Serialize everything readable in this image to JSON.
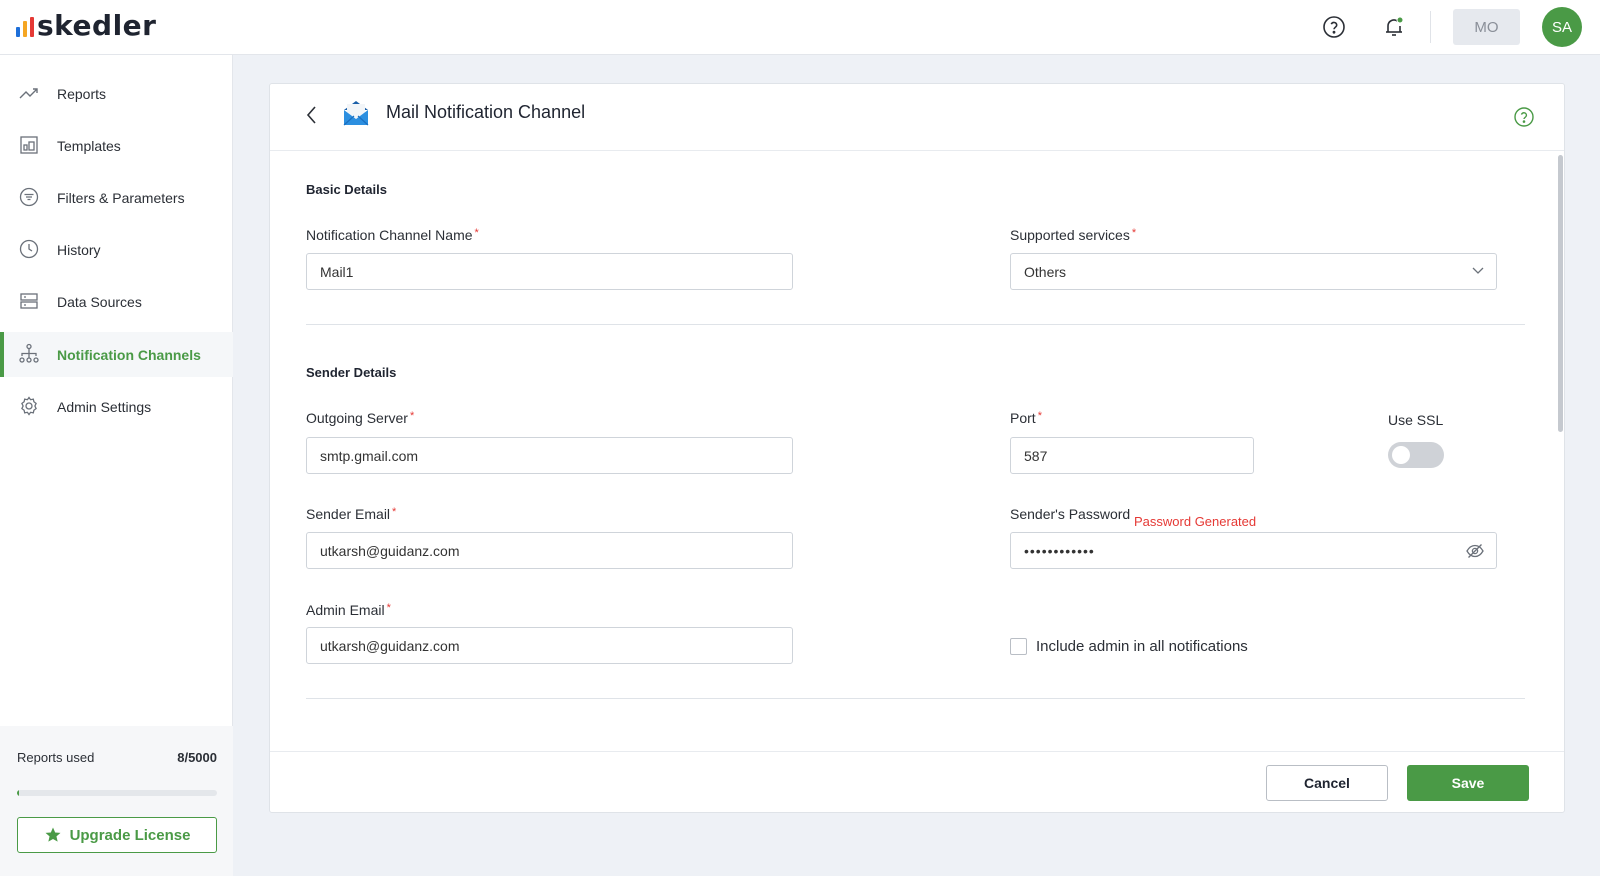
{
  "app": {
    "logo_text": "skedler",
    "logo_bar_colors": [
      "#1e6fd9",
      "#f5a623",
      "#e53935"
    ],
    "accent_color": "#4a9a46"
  },
  "topbar": {
    "help_icon": "help-circle-icon",
    "bell_icon": "bell-icon",
    "org_button_label": "MO",
    "avatar_initials": "SA"
  },
  "sidebar": {
    "items": [
      {
        "label": "Reports",
        "icon": "trending-up-icon"
      },
      {
        "label": "Templates",
        "icon": "template-icon"
      },
      {
        "label": "Filters & Parameters",
        "icon": "filter-icon"
      },
      {
        "label": "History",
        "icon": "clock-icon"
      },
      {
        "label": "Data Sources",
        "icon": "server-icon"
      },
      {
        "label": "Notification Channels",
        "icon": "hierarchy-icon",
        "active": true
      },
      {
        "label": "Admin Settings",
        "icon": "gear-icon"
      }
    ],
    "usage": {
      "label": "Reports used",
      "value": "8/5000",
      "used": 8,
      "total": 5000
    },
    "upgrade_label": "Upgrade License"
  },
  "card": {
    "title": "Mail Notification Channel",
    "sections": {
      "basic": "Basic Details",
      "sender": "Sender Details"
    },
    "fields": {
      "channel_name": {
        "label": "Notification Channel Name",
        "value": "Mail1"
      },
      "supported_services": {
        "label": "Supported services",
        "value": "Others"
      },
      "outgoing_server": {
        "label": "Outgoing Server",
        "value": "smtp.gmail.com"
      },
      "port": {
        "label": "Port",
        "value": "587"
      },
      "use_ssl": {
        "label": "Use SSL",
        "enabled": false
      },
      "sender_email": {
        "label": "Sender Email",
        "value": "utkarsh@guidanz.com"
      },
      "sender_password": {
        "label": "Sender's Password",
        "value": "••••••••••••",
        "status": "Password Generated"
      },
      "admin_email": {
        "label": "Admin Email",
        "value": "utkarsh@guidanz.com"
      },
      "include_admin": {
        "label": "Include admin in all notifications",
        "checked": false
      }
    },
    "required_mark": "*",
    "buttons": {
      "cancel": "Cancel",
      "save": "Save"
    }
  }
}
